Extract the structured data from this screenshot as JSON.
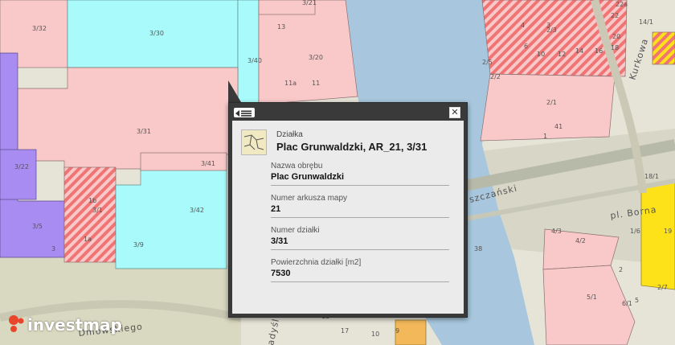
{
  "map": {
    "parcel_labels": [
      "3/32",
      "3/30",
      "3/21",
      "3/40",
      "13",
      "3/20",
      "11a",
      "11",
      "4",
      "3",
      "6",
      "10",
      "12",
      "14",
      "16",
      "22a",
      "22",
      "20",
      "18",
      "14/1",
      "2/3",
      "2/5",
      "2/2",
      "2/1",
      "41",
      "1",
      "3/31",
      "3/41",
      "3/22",
      "1b",
      "3/1",
      "3/5",
      "1a",
      "3/42",
      "3/9",
      "3",
      "4/3",
      "4/2",
      "5/1",
      "6/1",
      "5",
      "2",
      "18/1",
      "19",
      "1/6",
      "2/7",
      "38",
      "17",
      "10",
      "9",
      "13"
    ],
    "street_labels": [
      "Dmowskiego",
      "Kurkowa",
      "pl. Borna",
      "szczański",
      "adyśl"
    ],
    "colors": {
      "residential": "#f9c9c9",
      "service": "#a9fbfb",
      "purple": "#a98cf2",
      "river": "#a7c6dd",
      "hatch": "#f08686",
      "yellow": "#fde21a"
    }
  },
  "popup": {
    "menu_icon": "list-icon",
    "close_glyph": "✕",
    "header_caption": "Działka",
    "header_title": "Plac Grunwaldzki, AR_21, 3/31",
    "fields": [
      {
        "label": "Nazwa obrębu",
        "value": "Plac Grunwaldzki"
      },
      {
        "label": "Numer arkusza mapy",
        "value": "21"
      },
      {
        "label": "Numer działki",
        "value": "3/31"
      },
      {
        "label": "Powierzchnia działki [m2]",
        "value": "7530"
      }
    ]
  },
  "brand": {
    "name": "investmap"
  }
}
